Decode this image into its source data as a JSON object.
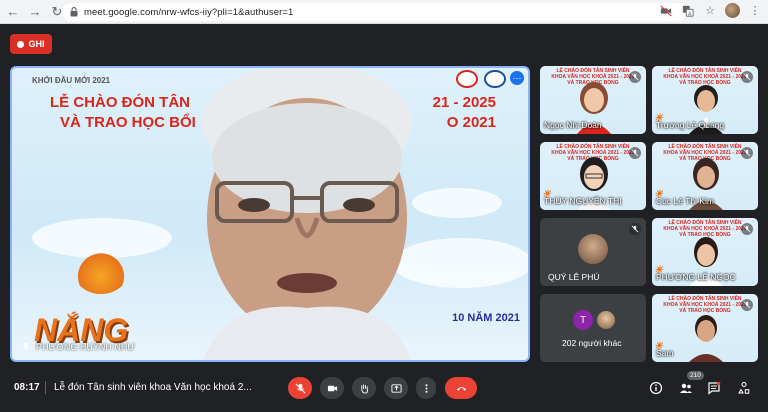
{
  "browser": {
    "url": "meet.google.com/nrw-wfcs-iiy?pli=1&authuser=1"
  },
  "recording": {
    "label": "GHI"
  },
  "main": {
    "slide_tagline": "KHỞI ĐẦU MỚI 2021",
    "slide_line1_left": "LỄ CHÀO ĐÓN TÂN",
    "slide_line1_right": "21 - 2025",
    "slide_line2_left": "VÀ TRAO HỌC BỔI",
    "slide_line2_right": "O 2021",
    "slide_word": "NẮNG",
    "slide_date": "10 NĂM 2021",
    "speaker_name": "PHƯƠNG HUỲNH NHƯ"
  },
  "participants": [
    {
      "name": "Ngọc Nhi Đoàn"
    },
    {
      "name": "Trương Lê Quang"
    },
    {
      "name": "THÚY NGUYỄN THỊ"
    },
    {
      "name": "Cúc Lê Thị Kim"
    },
    {
      "name": "QUÝ LÊ PHÚ"
    },
    {
      "name": "PHƯƠNG LÊ NGỌC"
    },
    {
      "name": "202 người khác",
      "avatar_letter": "T"
    },
    {
      "name": "Sam"
    }
  ],
  "mini_slide_text": "LỄ CHÀO ĐÓN TÂN SINH VIÊN KHOA VĂN HỌC KHOÁ 2021 - 2025 VÀ TRAO HỌC BỔNG",
  "bottom_bar": {
    "time": "08:17",
    "meeting_title": "Lễ đón Tân sinh viên khoa Văn học khoá 2...",
    "people_count": "210"
  },
  "colors": {
    "end_call": "#ea4335",
    "active_border": "#8ab4f8",
    "record": "#d93025"
  },
  "icons": [
    "back-icon",
    "forward-icon",
    "reload-icon",
    "lock-icon",
    "camera-blocked-icon",
    "translate-icon",
    "star-icon",
    "mic-off-icon",
    "camera-icon",
    "raise-hand-icon",
    "present-icon",
    "more-icon",
    "end-call-icon",
    "info-icon",
    "people-icon",
    "chat-icon",
    "activities-icon"
  ]
}
